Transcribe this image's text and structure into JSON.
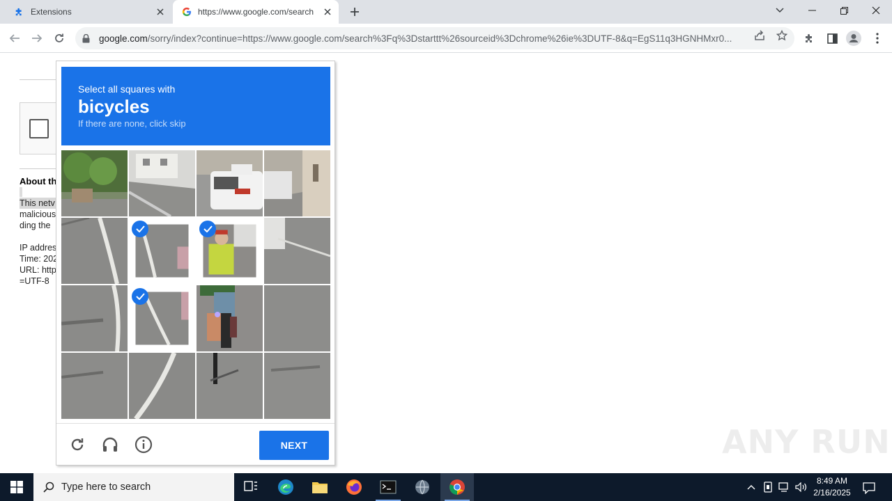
{
  "browser": {
    "tabs": [
      {
        "title": "Extensions"
      },
      {
        "title": "https://www.google.com/search"
      }
    ],
    "url_host": "google.com",
    "url_rest": "/sorry/index?continue=https://www.google.com/search%3Fq%3Dstarttt%26sourceid%3Dchrome%26ie%3DUTF-8&q=EgS11q3HGNHMxr0..."
  },
  "page": {
    "about_heading": "About th",
    "lines": [
      "This netv",
      "malicious",
      "ding the",
      "IP addres",
      "Time: 202",
      "URL: http",
      "=UTF-8"
    ]
  },
  "captcha": {
    "instruction": "Select all squares with",
    "target": "bicycles",
    "hint": "If there are none, click skip",
    "grid_size": 4,
    "selected_tiles": [
      5,
      6,
      9
    ],
    "next_label": "NEXT",
    "icons": [
      "reload-icon",
      "audio-headphones-icon",
      "info-icon"
    ]
  },
  "watermark": "ANY RUN",
  "taskbar": {
    "search_placeholder": "Type here to search",
    "time": "8:49 AM",
    "date": "2/16/2025"
  },
  "colors": {
    "accent": "#1a73e8",
    "taskbar": "#0d1a2b",
    "tabstrip": "#dee1e6"
  }
}
